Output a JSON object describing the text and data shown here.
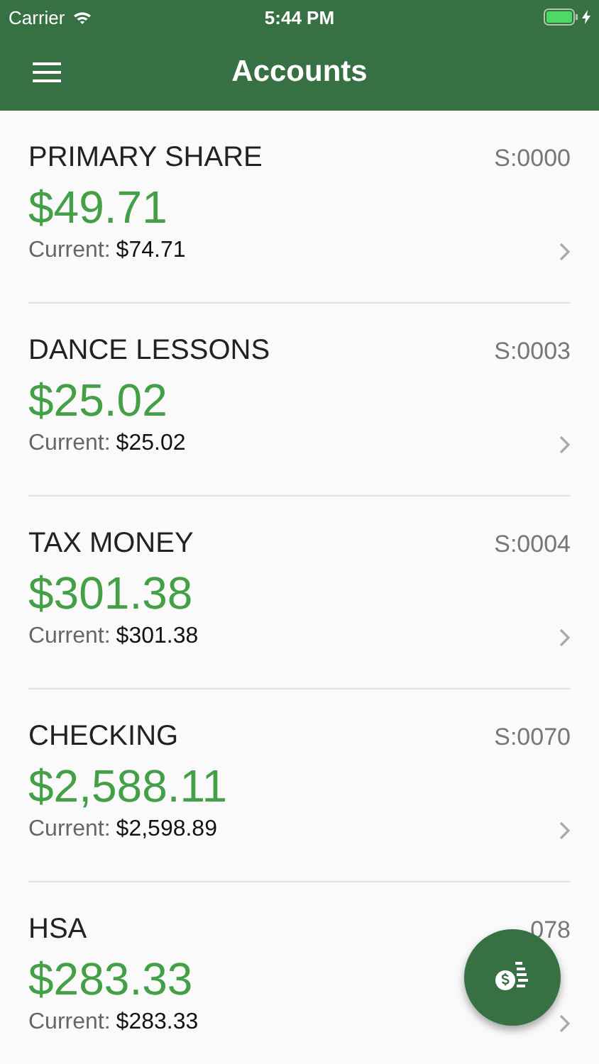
{
  "status_bar": {
    "carrier": "Carrier",
    "time": "5:44 PM",
    "charging": true
  },
  "header": {
    "title": "Accounts"
  },
  "accounts": [
    {
      "name": "PRIMARY SHARE",
      "code": "S:0000",
      "available": "$49.71",
      "current_label": "Current:",
      "current": "$74.71"
    },
    {
      "name": "DANCE LESSONS",
      "code": "S:0003",
      "available": "$25.02",
      "current_label": "Current:",
      "current": "$25.02"
    },
    {
      "name": "TAX MONEY",
      "code": "S:0004",
      "available": "$301.38",
      "current_label": "Current:",
      "current": "$301.38"
    },
    {
      "name": "CHECKING",
      "code": "S:0070",
      "available": "$2,588.11",
      "current_label": "Current:",
      "current": "$2,598.89"
    },
    {
      "name": "HSA",
      "code": "078",
      "available": "$283.33",
      "current_label": "Current:",
      "current": "$283.33"
    }
  ]
}
